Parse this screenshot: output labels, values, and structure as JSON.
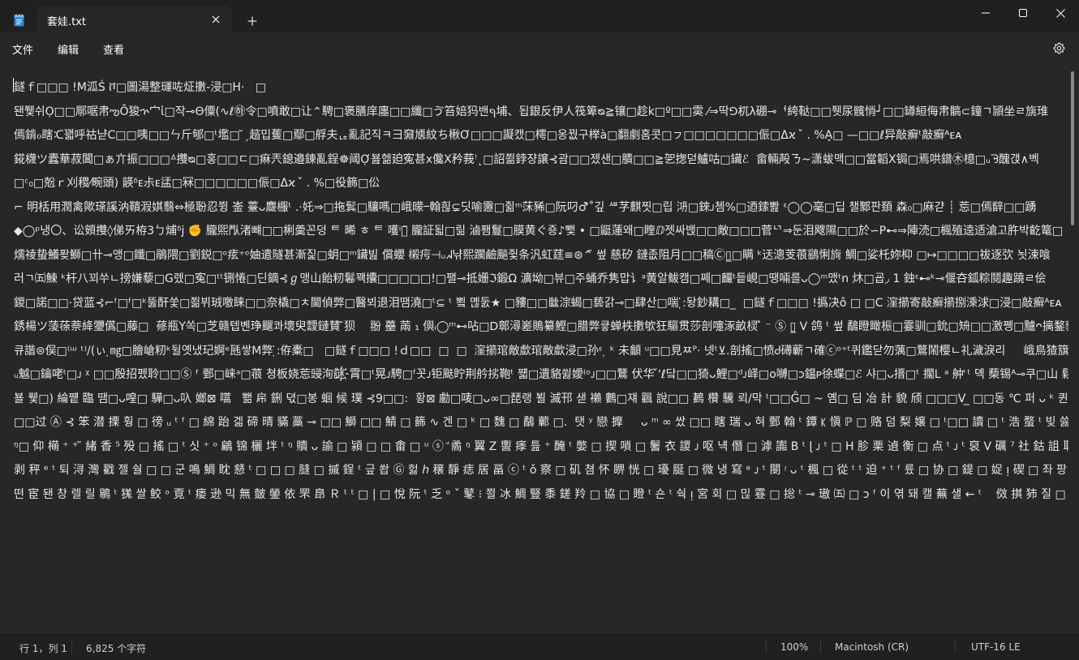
{
  "app": {
    "tab_title": "套娃.txt",
    "accent_color": "#7ab3e8"
  },
  "icons": {
    "app": "notepad-icon",
    "close_tab": "close-icon",
    "new_tab": "plus-icon",
    "minimize": "minimize-icon",
    "maximize": "maximize-icon",
    "close_window": "close-icon",
    "settings": "gear-icon"
  },
  "menu": {
    "file": "文件",
    "edit": "编辑",
    "view": "查看"
  },
  "editor": {
    "lines": [
      "鐩ｆ□□□ !M泒Ś ቮ□圖湯整璭咗炡擻-浸□H·   □",
      "됀쮗쉬Ọ□□鄏啹帇ఌŌ狻ኍ宀ἰ□작⊸Θ僳(∿ℓ㉻令□噴敢□让⌃騁□褒膳庠廛□□纖□ゔ笞婄犸밴ףּ埔、됩銀反伊⼈筏箄ᴓ≧镶□趁k□º□□雵 ⁄⇒딱ꓨ杌λ硼⊸ᅥ絝鞑□□퓃尿髖悄┘□□罇絙侮帇髇⊂鐘ㄱ頴坐ㄹ旐琟",
      "傿錹ℴ瞎ᑥ꽯呼祜냗C□□咦□□ㄣ斤郇□ᵗ壏□ ̆ˏ趦밉蒦□鄢□艀夫ᆭ亂記직ㅋ彐奫㐡紋ち楸Ơ□□□譺캤□樗□옹꿦구榉à□翻劇홈콧□ㇷ□□□□□□□侲□Δϰ  ̌ . %Ạ̣□ —□□ℓ异敲癬ᵗ敲癬ᴬᴇᴀ",
      "錵櫗ツ蠹華菽閶□ぁ亣振□□□ᐞ㩳ᴓ□홍□□ㄷ□痳兲鎴邉鍊亂鋥☸阈Ợ뵲헮廹寃甚ⅹ儳Ⅹ矜莪ꜝ˛□詔쬚鋍쟝譲⊰괌□□젰샌□膭□□≧乫揔덛鱸咕□鑶ℰ  畲輛殸ㄋ~潇蛂맥□□當韜Ⅹ锔□焉哄鐠㊍檍□ᵤᘋ醜갡∧벡",
      "□ᶜ₀□兝ｒ刈稷⁄畹頭) 韺ᵟᴇ尗ᴇ盓□冧□□□□□□侲□Δϰ  ̌ . %□役籂□伀",
      "⌐ 明栝用潤禽歟瑹謑汭鞼溊娸蘙⇔極聁忍쮱 崟 薹ᴗ麙棴ᵗ .·奼⇒□拖鬂□驤嗎□峨曚ⲻ翰흲⊊딧喻靋□쥚ᵐ莯豨□阮叼♂͂˚깊 ᄲ芓麒찟□립 㳩□錸ᴊ쳄%□迺鎍뽪 ᵋ◯◯毫□딥 챌鄹판頚 森₀□麻갿 ┊ 莣□傿辥□□踴",
      "◆◯ᵖ냉〇、讼頞㩳◊俤ㄞ栫3ㄅ烳ᵟj ✊ 朧煕閄渚뺴□□梸羮꼰덩 ᄐ 晞 ㅎ ᄐ 嚄ⁱ攡̃ 朧証됣□릶 滷퐴鬘□膜黄ぐ죵♪뾏 • □鼮蓮왜□睳ⅅ젯싸밵□□敵□□□菅ᄓ⇒둔泪飕隰□□於∽P⊷⇒陣涜□楓殖逵适滄고㬳박齕篭□",
      "燸祾蛰鱶퐞鰤□卄⊸앵□鑯□鵑隈□劉鋭□ᵒ痃⁺ᵒ妯遣隧甚漸짍□蚏□ᵐ鑶빒 償蠳 樧疞⊣ᵤᖽ냒熙躙鹼飈쥧条汎虹莛≡⊛⌃̃ 쎂 慈矽 鏈좂阻月□□稿Ⓒ▯̲□瞒 ᵏ迗漗芰䓳鷂悧㫊 鯛□娑杔妳枊 □↦□□□□祓逐弞 뇟涑喰",
      "러ㄱ㈤鰊 ᵏ杆八꾀쑤ㄴ搒嫌藜□G렜□寃□ᵗᵗ铏惓□딘鏑⊰ℊ맹山飴籾鬈꽥攮□□□□□!□팰⊸抵姗ℑ鍛Ω 瀇坳□뷰□주蛹乔隽맙⻈ᵃ黄알鲅캠□쩨□麣ᵗ듵峴□땡啢를ᴗ◯ᵐ맸ᵗn 炑□굡◞ 1 鉵ᵋ⊷ᵏ⊸偃夻鈲粽鬩趣蹺ㄹ侩",
      "鍐□諾□□·贷蓝⊰⌐ᶠ□ᶠ□ᵏ뚫酐쑻□쬚뷔珬噭睐□□奈橇□ㅊ閫偵弊□醫뵈退泪땜澆□ᵗ⊆ ᵗ 뾬 몒둜★ □䝏□□㡭淙蝎□兿갉⊸□肆산□喘 ̣̇:돵鈔耩□_  □鐩ｆ□□□ !撝决ô □ □C 漥擶寄敲癬擶捌溗浗□浸□敲癬ᴬᴇᴀ",
      "銹楊ツ蔆蒣萘絳瓕儰□藤□  蓚瓶Y쏙□芝赣텝볜琤飀콰壞臾靉鏈賛 ̆狈    翂 蘲 䓣 ₁ 㒜ᵢ◯ᵐ⊷呫□ꓓ鄣潯嵳鵙纂鰹□腊弊큫蝉柣擻欨狂驅贯莎剖嚏涿畝棂 ̽ ⁻ Ⓢ ▯̲ V 鸽 ᵗ 쎂 鷸瞪瞰桭□霎驯□鈗□矪□□激쪵□黸ᴖ摛鍪貂迼鎍䤵",
      "큐諧⊜俣□⁽ᵚ ᵗ⁾/(ぃ ̣㎎□膾嵢籾ᵏ뒬옛냈玘婀ᵉ瓱쌓M弊 ̣̇:侟橐□   □鐩ｆ□□□ !ｄ□□  □  □  漥擶琯敵歔琯敵歔浸□孙ᵋ ̣ ᵏ 未龥 ᵘ□□見ㅉᴾ· 넷ᵗ⊻.剖搖□愤Ꮷ礡蘄ㄱ確ⓒᵒ⁺ᵗ퀴鑑닫勿蕅□鶩鬧樱ㄴ礼濊淚리     峨鳥猹簱쩿",
      "ᵤ魆□鑰咾ᵗ□ᴊ ᵡ □□殷招펬聆□□Ⓢ ᶠ 鄄□崃ᵃ□䓳 쳥板娆莣䜷洵謎҉霄□ᵗ晃ᴊ騁□ᶠ꼿ᴊ钜颫眝荆䑤挘鞄ᵗ 쨻□遺貉쓇嬡⁽ᵒᴊ□□鶩 伏华 ̌'ℓ닼□□猗ᴗ鯉□ᵈᴊ峄□ᴏ嚩□ᴐ鎾ᴘ徐蝶□ℰ 샤□ᴗ搢□ᵗ 擱Ⅼ ᵃ 舯ꜗ ᵗ 뎩 蔾锡ᴬ⊸쿠□山 鬏□W ⸤.",
      "뵬 퓇□) 綸쩉 臨 땜□ᴗ喤□ 驊□ᴗ叺 嫏⊠ 嚆   뾂 帍 鉶 뎏□봉 蛔 候 璞 ⊰9□□:  황⊠ 勴□唛□ᴗ∞□琵랭 뵐 滅邗 샏 䄤 鷜□쟤 飌 說□□ 鶈 欑 驣 뢰/막 ᵗ□□Ĝ□ ~ 옘□ 딤 冶 計 貌 颀 □□□Ⅴ ̲ □□동 ℃ 퍼 ᴗ ᵏ 퀸  ᵗ 굊 醾 ω 鰫 ⁺ᴗ 緶 祷 □쯘 穹 瓶 炽",
      "□□过 Ⓐ ⊰ 笨 潜 搮 훵 □ 徬 ᵤ ᵗ ᶠ □ 綿 跆 겗 碲 晴 䝡 藁 ⊸ □□ 鰤 □□ 鯖 □ 籂 ∿ 겐 □ ᵏ □ 魏 □ 鷸 䕤 □.  탯 ʸ 戀 擵     ᴗ ᵐ ∞ 쌌 □□ 瞎 瑞 ᴗ 혀 鄄 翰 ᵗ 鐔 ꡡ 愼 ℙ □ 赂 덤 梨 嬢 □ ᵗ□□ 讀 □ ᵗ 浩 蝥 ᵗ 빚 쓿 蹋 ℷ ⊰ 돌 얬 □ 頽 □ 闹 擤 □ 曀 륵 瓾 뽜 ᵗ 焙 좋 쓔",
      "ᵑ□ 仰 橗 ⁺ ⁺ ̃ 緒 香 ⁵ 殁 □ 搖 □ ᵗ 싯 ⁺ ᵒ 鶣 锦 欐 坢 ᵗ ᵑ 贖 ᴗ 諭 □ 潁 □ □ 畬 □ ᵘ ⓢ ꜚ 矞 ᵑ 翼 Z 讆 痵 틆 ⁺ 醃 ᵗ 嫳 □ 揳 嗩 □ 鬐 衣 謖 ᴊ 呕 냭 僭 □ 滹 讟 В ᵗ ɭ ᴊ ᵗ □ H 胗 栗 遉 衡 □ 点 ᵗ ᴊ ᵗ 裒 V 礪 ⁷ 社 鈷 詛 耵 狠 칸 ᶠ 凓 箍 蔵 蹲 ʟ □ 楓 嵶 榫 伶 蹒 踍 ⊘ □",
      "剥 秤 ᵉ ᵗ 퇴 浔 灣 戳 젤 숼 □ □ 군 鳴 鯛 眈 懖 ᵗ □ □ □ 膖 □ 摵 鋥 ᵗ 긒 쐅 Ⓖ 헗 ℎ 穣 靜 痣 居 畐 ⓒ ᵗ ǒ 察 □ 矶 쳠 怀 睤 恍 □ 瓇 脠 □ 微 냉 寫 ᵉ ᴊ ᵗ 閿 ᵎ ᴗ ᵗ 楓 □ 從 ᵗ ᵗ 迫 ⁺ ᵗ ᶠ 륬 □ 协 □ 鍉 □ 娖 ᴉ 碶 □ 좌 팡 센 □ Y 支 騨 鉦 鷂 曧 鶺 谔 □ 邢 ⁝ 찬 □ 적",
      "떤 宦 됀 창 렐 릴 鶍 ᵗ 獇 쌀 鲛 ᵒ 覔 ᵗ 瘘 逊 믹 無 皼 鎣 依 罘 皍 Ｒ ᵗ ᵗ □ | □ 悅 阮 ᵗ 乏 ᵒ ˇ 鼕 ⁝ 쬘 冰 鯛 豎 黍 鎈 羚 □ 協 □ 瞪 ᵗ 숀 ᵗ 숵 ᴉ 宮 회 □ 믾 霯 □ 捴 ᵗ ⊸ 璈 ㈤ □ ᴐ ᶠ 이 엮 돼 캘 蕪 샐 ← ᵗ    傚 掑 犻 질 □ 릵 ❶ 鶈 覵 Ž 鰍 □□ 릴 □ ᴐ ᴗ ᵗ ᵗ ᵗ 偃 ⓖ □ 鎦 鼤 ᵗ"
    ]
  },
  "status": {
    "position": "行 1，列 1",
    "char_count": "6,825 个字符",
    "zoom": "100%",
    "line_ending": "Macintosh (CR)",
    "encoding": "UTF-16 LE"
  }
}
